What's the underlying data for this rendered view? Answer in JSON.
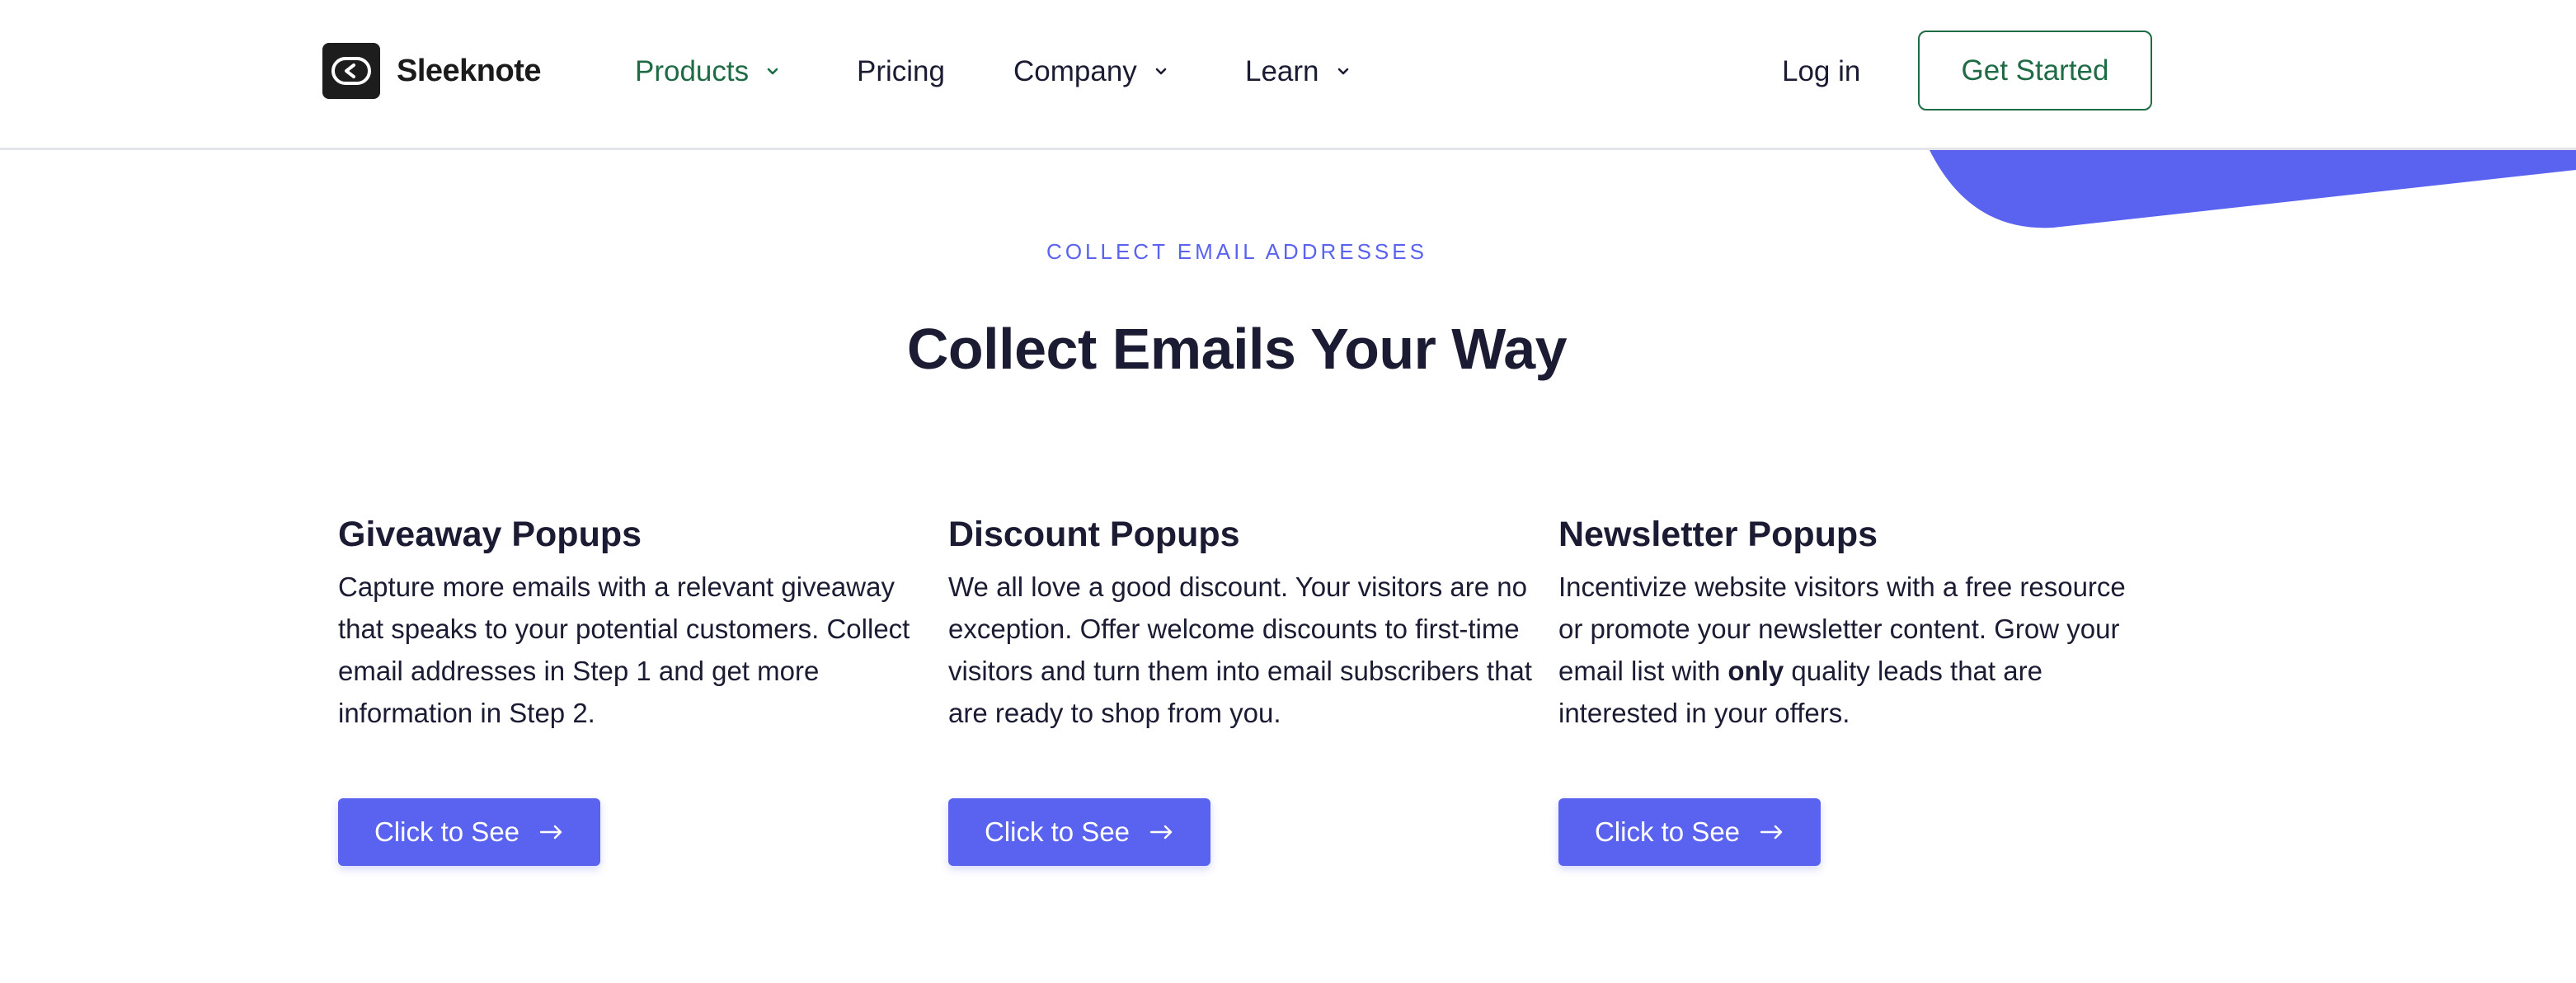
{
  "brand": {
    "name": "Sleeknote"
  },
  "nav": {
    "items": [
      {
        "label": "Products",
        "has_dropdown": true,
        "active": true
      },
      {
        "label": "Pricing",
        "has_dropdown": false,
        "active": false
      },
      {
        "label": "Company",
        "has_dropdown": true,
        "active": false
      },
      {
        "label": "Learn",
        "has_dropdown": true,
        "active": false
      }
    ],
    "login_label": "Log in",
    "cta_label": "Get Started"
  },
  "section": {
    "eyebrow": "COLLECT EMAIL ADDRESSES",
    "title": "Collect Emails Your Way"
  },
  "cards": [
    {
      "title": "Giveaway Popups",
      "body": "Capture more emails with a relevant giveaway that speaks to your potential customers. Collect email addresses in Step 1 and get more information in Step 2.",
      "button": "Click to See"
    },
    {
      "title": "Discount Popups",
      "body": "We all love a good discount. Your visitors are no exception. Offer welcome discounts to first-time visitors and turn them into email subscribers that are ready to shop from you.",
      "button": "Click to See"
    },
    {
      "title": "Newsletter Popups",
      "body_before": "Incentivize website visitors with a free resource or promote your newsletter content. Grow your email list with ",
      "body_bold": "only",
      "body_after": " quality leads that are interested in your offers.",
      "button": "Click to See"
    }
  ],
  "colors": {
    "accent": "#5a63f0",
    "brand_green": "#1f6b45",
    "text": "#1b1c33"
  },
  "icons": [
    "logo-icon",
    "chevron-down-icon",
    "arrow-right-icon"
  ]
}
